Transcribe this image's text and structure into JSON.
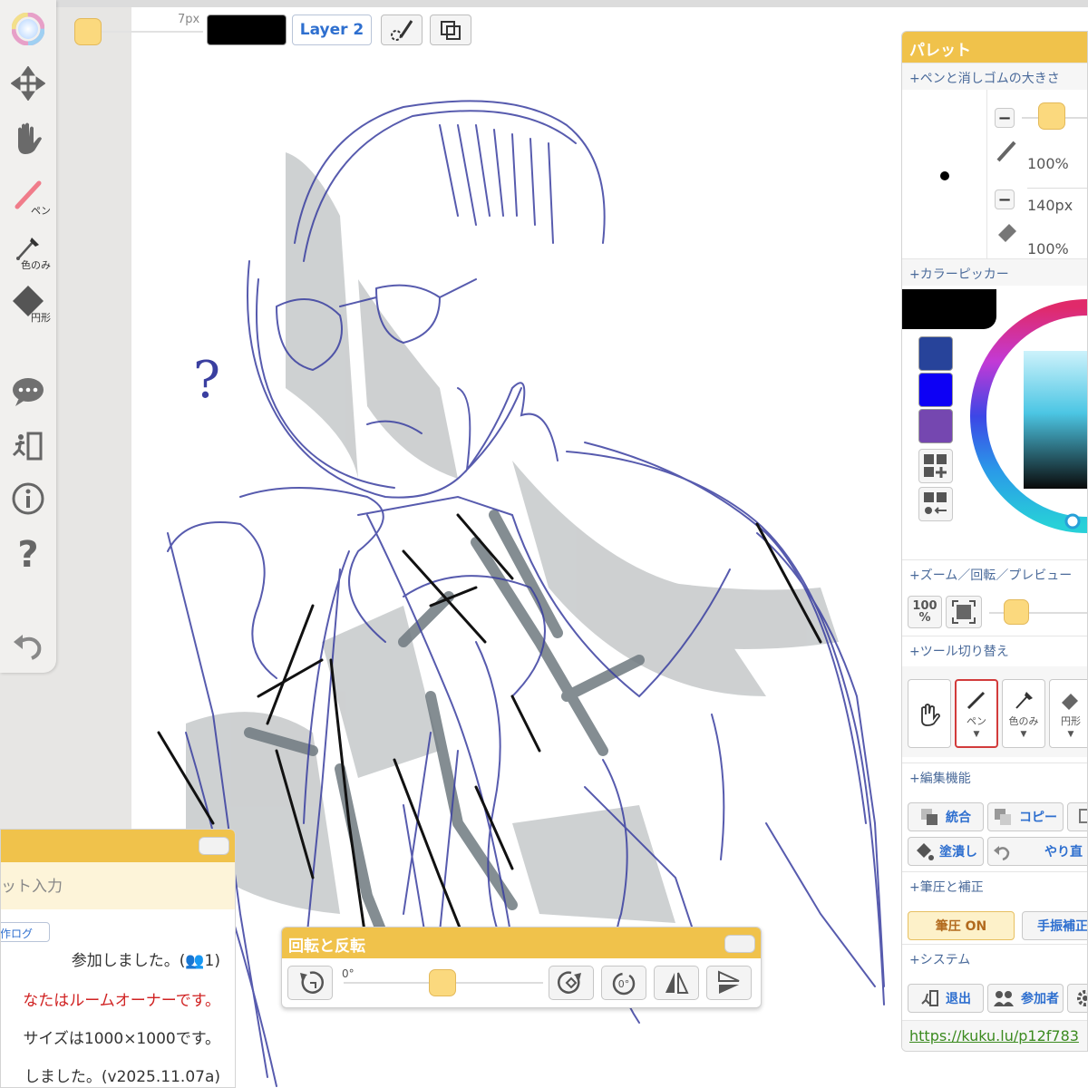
{
  "topbar": {
    "size_label": "7px",
    "layer_label": "Layer 2",
    "current_color": "#000000",
    "thumb_color": "#fbd97e"
  },
  "toolbar": {
    "pen_label": "ペン",
    "eyedropper_label": "色のみ",
    "shape_label": "円形"
  },
  "palette": {
    "title": "パレット",
    "sections": {
      "size": "+ペンと消しゴムの大きさ",
      "color": "+カラーピッカー",
      "zoom": "+ズーム／回転／プレビュー",
      "tools": "+ツール切り替え",
      "edit": "+編集機能",
      "pressure": "+筆圧と補正",
      "system": "+システム"
    },
    "pen_opacity": "100%",
    "eraser_size": "140px",
    "eraser_opacity": "100%",
    "swatches": [
      "#27439a",
      "#0d00f5",
      "#7547b0"
    ],
    "zoom_value_top": "100",
    "zoom_value_bottom": "%",
    "tool_buttons": {
      "pen": "ペン",
      "eyedropper": "色のみ",
      "shape": "円形"
    },
    "edit_buttons": {
      "merge": "統合",
      "copy": "コピー",
      "fill": "塗潰し",
      "redo": "やり直"
    },
    "pressure_buttons": {
      "pressure_on": "筆圧 ON",
      "stabilizer": "手振補正"
    },
    "system_buttons": {
      "exit": "退出",
      "participants": "参加者"
    },
    "room_link": "https://kuku.lu/p12f783"
  },
  "chat": {
    "input_placeholder": "ット入力",
    "tab_label": "作ログ",
    "messages": [
      "参加しました。(👥1)",
      "なたはルームオーナーです。",
      "サイズは1000×1000です。",
      "しました。(v2025.11.07a)"
    ]
  },
  "rotate": {
    "title": "回転と反転",
    "angle": "0°"
  },
  "canvas": {
    "question_mark": "?"
  }
}
